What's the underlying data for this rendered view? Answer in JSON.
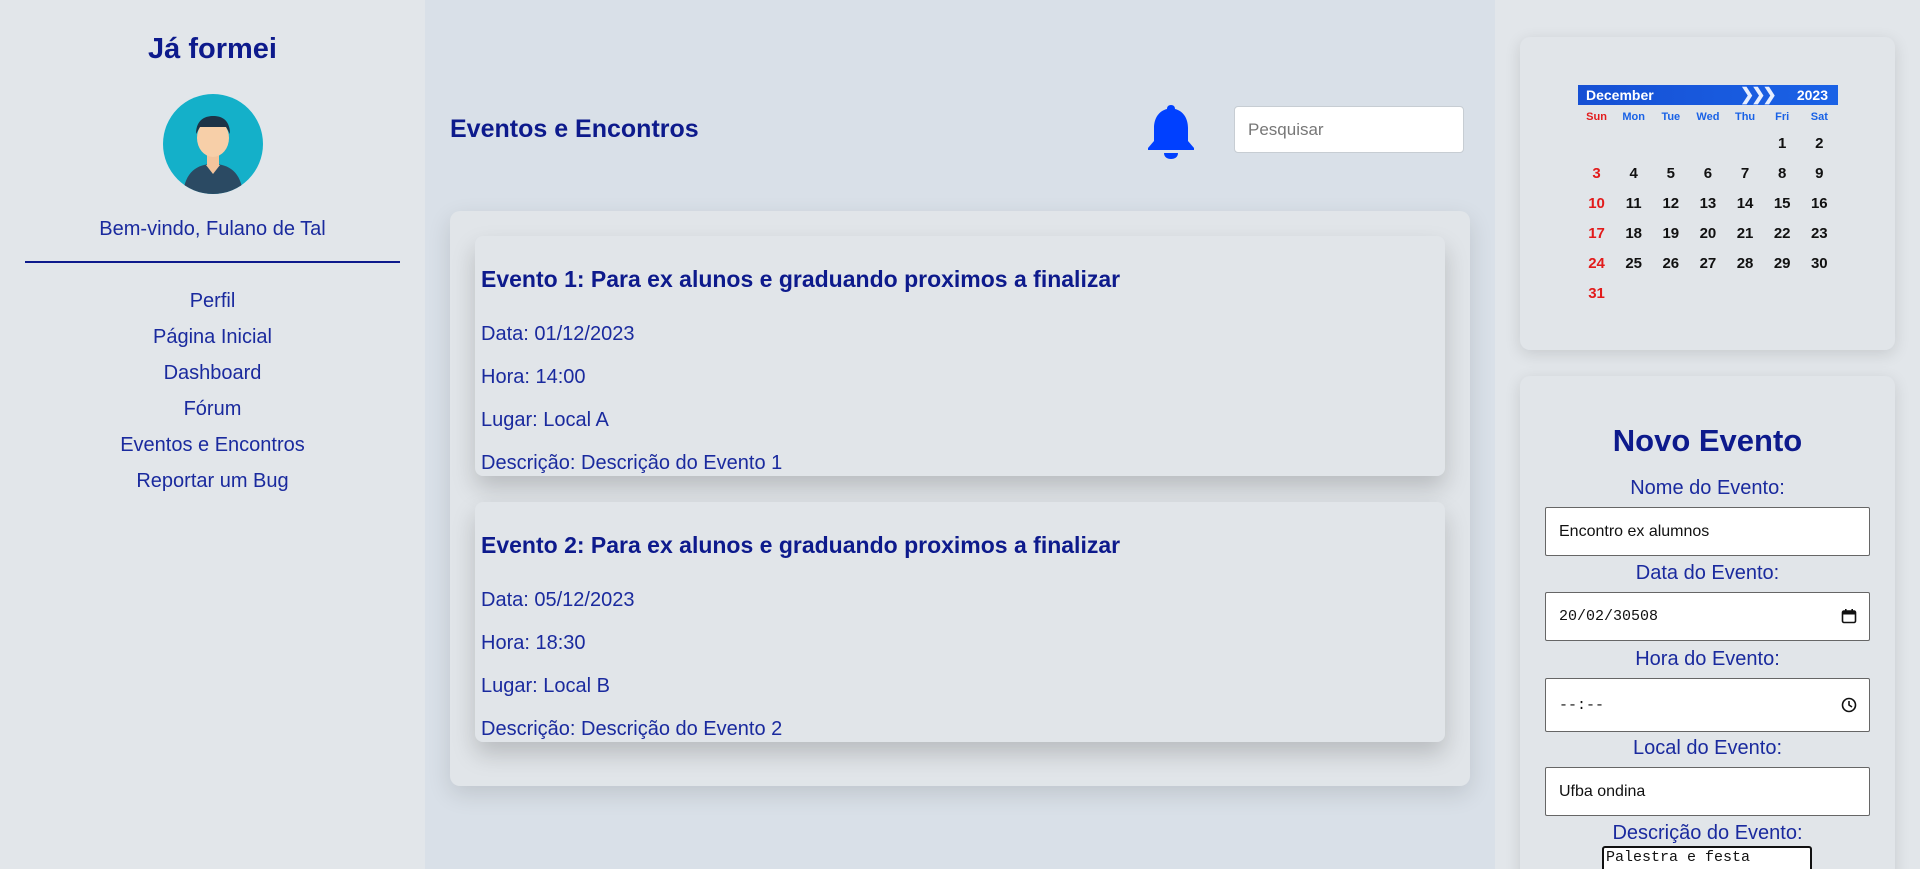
{
  "sidebar": {
    "brand": "Já formei",
    "welcome": "Bem-vindo, Fulano de Tal",
    "nav": [
      "Perfil",
      "Página Inicial",
      "Dashboard",
      "Fórum",
      "Eventos e Encontros",
      "Reportar um Bug"
    ]
  },
  "header": {
    "title": "Eventos e Encontros",
    "bell_icon": "bell-icon",
    "search_placeholder": "Pesquisar"
  },
  "events": [
    {
      "title": "Evento 1: Para ex alunos e graduando proximos a finalizar",
      "date": "Data: 01/12/2023",
      "time": "Hora: 14:00",
      "place": "Lugar: Local A",
      "description": "Descrição: Descrição do Evento 1"
    },
    {
      "title": "Evento 2: Para ex alunos e graduando proximos a finalizar",
      "date": "Data: 05/12/2023",
      "time": "Hora: 18:30",
      "place": "Lugar: Local B",
      "description": "Descrição: Descrição do Evento 2"
    }
  ],
  "calendar": {
    "month": "December",
    "year": "2023",
    "weekdays": [
      "Sun",
      "Mon",
      "Tue",
      "Wed",
      "Thu",
      "Fri",
      "Sat"
    ],
    "weeks": [
      [
        "",
        "",
        "",
        "",
        "",
        "1",
        "2"
      ],
      [
        "3",
        "4",
        "5",
        "6",
        "7",
        "8",
        "9"
      ],
      [
        "10",
        "11",
        "12",
        "13",
        "14",
        "15",
        "16"
      ],
      [
        "17",
        "18",
        "19",
        "20",
        "21",
        "22",
        "23"
      ],
      [
        "24",
        "25",
        "26",
        "27",
        "28",
        "29",
        "30"
      ],
      [
        "31",
        "",
        "",
        "",
        "",
        "",
        ""
      ]
    ],
    "colors": {
      "header": "#1a62e6",
      "sunday": "#e21b1b"
    }
  },
  "form": {
    "title": "Novo Evento",
    "name_label": "Nome do Evento:",
    "name_value": "Encontro ex alumnos",
    "date_label": "Data do Evento:",
    "date_value": "20/02/30508",
    "time_label": "Hora do Evento:",
    "time_value": "--:--",
    "place_label": "Local do Evento:",
    "place_value": "Ufba ondina",
    "description_label": "Descrição do Evento:",
    "description_value": "Palestra e festa"
  },
  "colors": {
    "primary": "#0d1a8c",
    "accent": "#0040ff",
    "avatar_bg": "#14b0c9"
  }
}
